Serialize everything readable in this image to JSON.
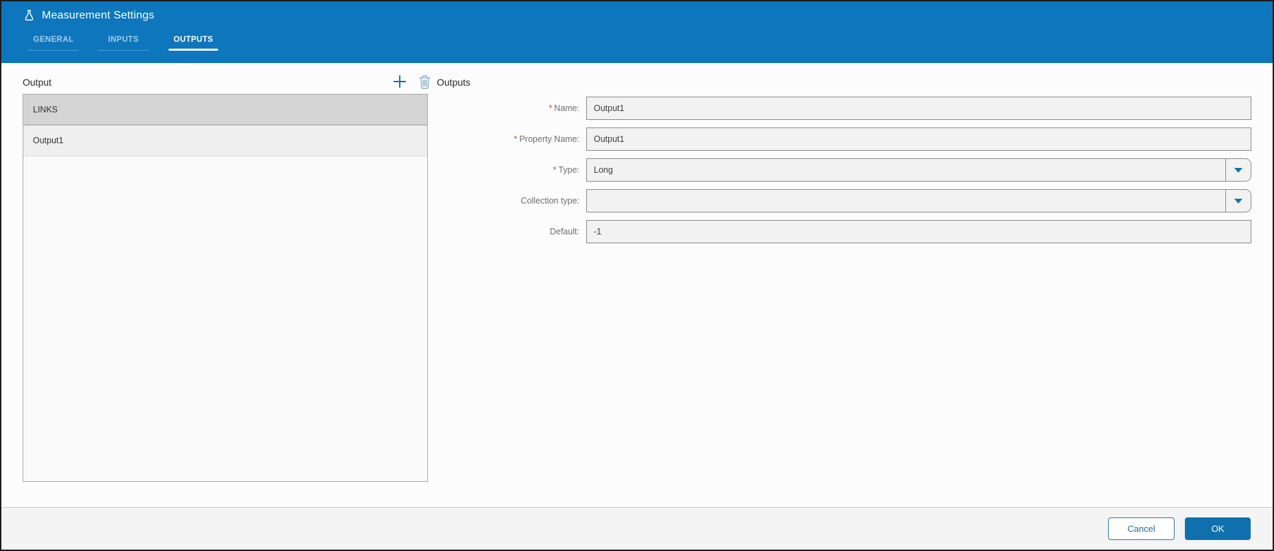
{
  "window": {
    "title": "Measurement Settings"
  },
  "icons": {
    "app": "flask-icon",
    "add": "plus-icon",
    "delete": "trash-icon",
    "dropdown": "caret-down-icon"
  },
  "required_marker": "*",
  "tabs": [
    {
      "label": "GENERAL",
      "active": false
    },
    {
      "label": "INPUTS",
      "active": false
    },
    {
      "label": "OUTPUTS",
      "active": true
    }
  ],
  "left_panel": {
    "heading": "Output",
    "items": [
      {
        "label": "LINKS",
        "selected": true
      },
      {
        "label": "Output1",
        "selected": false
      }
    ]
  },
  "right_panel": {
    "heading": "Outputs",
    "fields": [
      {
        "label": "Name:",
        "required": true,
        "kind": "text",
        "value": "Output1"
      },
      {
        "label": "Property Name:",
        "required": true,
        "kind": "text",
        "value": "Output1"
      },
      {
        "label": "Type:",
        "required": true,
        "kind": "dropdown",
        "value": "Long"
      },
      {
        "label": "Collection type:",
        "required": false,
        "kind": "dropdown",
        "value": ""
      },
      {
        "label": "Default:",
        "required": false,
        "kind": "text",
        "value": "-1"
      }
    ]
  },
  "footer": {
    "cancel_label": "Cancel",
    "ok_label": "OK"
  },
  "colors": {
    "header_blue": "#0e76bd",
    "accent_blue": "#1173b4",
    "ok_button_blue": "#1070ad",
    "required_asterisk": "#b25c1a",
    "selected_row_gray": "#d4d4d4"
  }
}
